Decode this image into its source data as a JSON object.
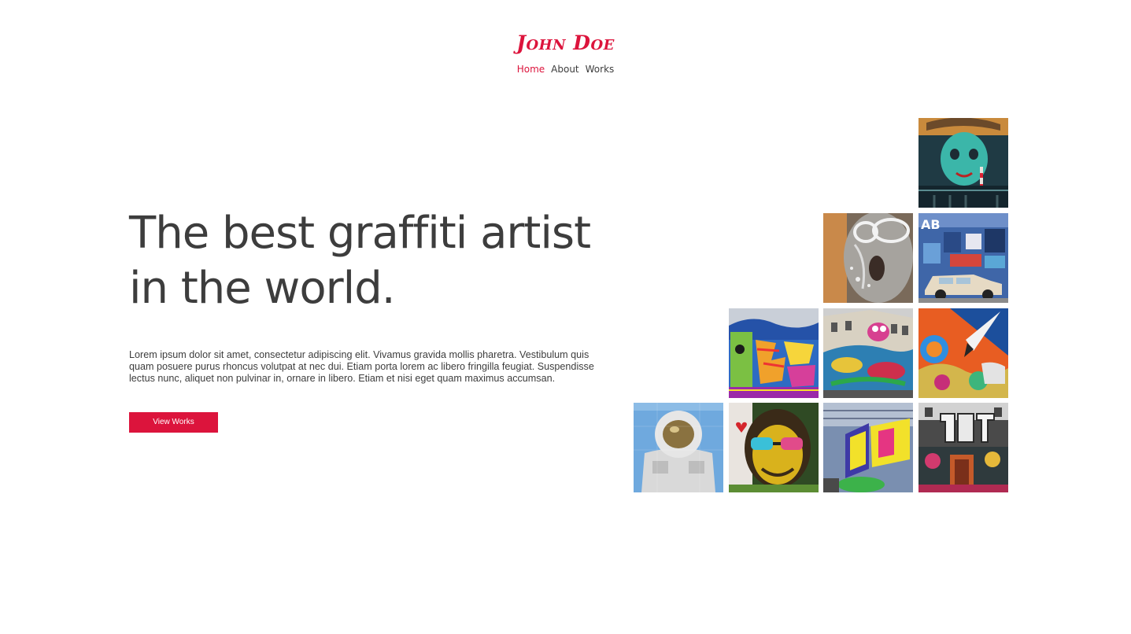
{
  "header": {
    "brand": "John Doe",
    "nav": [
      {
        "label": "Home",
        "active": true
      },
      {
        "label": "About",
        "active": false
      },
      {
        "label": "Works",
        "active": false
      }
    ]
  },
  "hero": {
    "title_line1": "The best graffiti artist",
    "title_line2": "in the world.",
    "description": "Lorem ipsum dolor sit amet, consectetur adipiscing elit. Vivamus gravida mollis pharetra. Vestibulum quis quam posuere purus rhoncus volutpat at nec dui. Etiam porta lorem ac libero fringilla feugiat. Suspendisse lectus nunc, aliquet non pulvinar in, ornare in libero. Etiam et nisi eget quam maximus accumsan.",
    "cta_label": "View Works"
  },
  "gallery": {
    "images": [
      {
        "name": "teal-face-mural"
      },
      {
        "name": "sketch-face-mural"
      },
      {
        "name": "blue-wall-with-car"
      },
      {
        "name": "colorful-letters-graffiti"
      },
      {
        "name": "building-mural"
      },
      {
        "name": "orange-rocket-mural"
      },
      {
        "name": "astronaut-mural"
      },
      {
        "name": "monkey-glasses-mural"
      },
      {
        "name": "yellow-letters-graffiti"
      },
      {
        "name": "alley-graffiti"
      }
    ],
    "tile_labels": {
      "blue_wall_sign": "AB"
    }
  },
  "colors": {
    "accent": "#dc143c",
    "text": "#3d3d3d",
    "background": "#ffffff"
  }
}
